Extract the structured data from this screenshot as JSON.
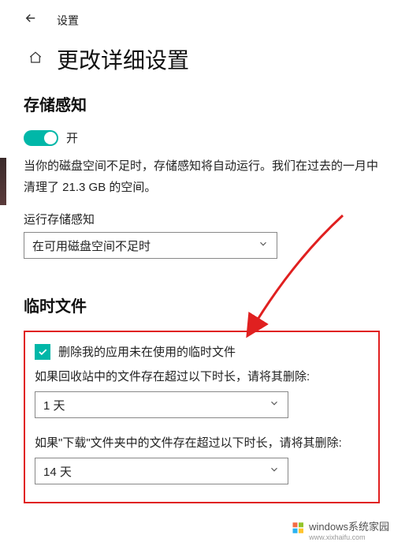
{
  "topbar": {
    "title": "设置"
  },
  "header": {
    "page_title": "更改详细设置"
  },
  "storage_sense": {
    "section_title": "存储感知",
    "toggle_label": "开",
    "description": "当你的磁盘空间不足时，存储感知将自动运行。我们在过去的一月中清理了 21.3 GB 的空间。",
    "run_label": "运行存储感知",
    "run_select_value": "在可用磁盘空间不足时"
  },
  "temp_files": {
    "section_title": "临时文件",
    "checkbox_label": "删除我的应用未在使用的临时文件",
    "recycle_label": "如果回收站中的文件存在超过以下时长，请将其删除:",
    "recycle_value": "1 天",
    "downloads_label": "如果\"下载\"文件夹中的文件存在超过以下时长，请将其删除:",
    "downloads_value": "14 天"
  },
  "watermark": {
    "brand": "windows系统家园",
    "url": "www.xixhaifu.com"
  },
  "colors": {
    "accent": "#00b7a8",
    "highlight_border": "#e02020"
  }
}
